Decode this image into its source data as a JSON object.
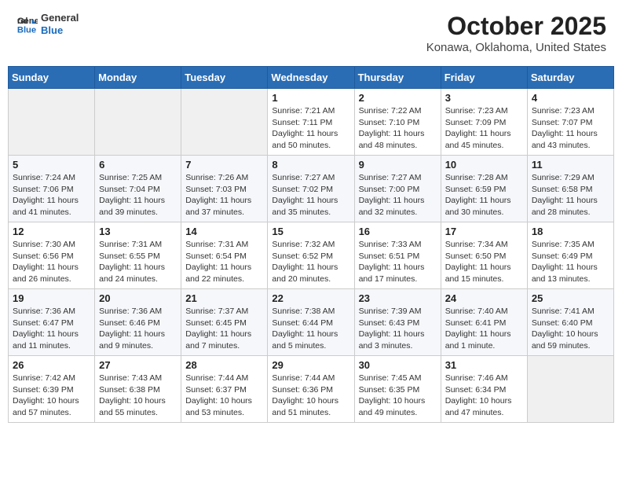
{
  "header": {
    "logo_line1": "General",
    "logo_line2": "Blue",
    "title": "October 2025",
    "subtitle": "Konawa, Oklahoma, United States"
  },
  "days_of_week": [
    "Sunday",
    "Monday",
    "Tuesday",
    "Wednesday",
    "Thursday",
    "Friday",
    "Saturday"
  ],
  "weeks": [
    [
      {
        "day": "",
        "info": ""
      },
      {
        "day": "",
        "info": ""
      },
      {
        "day": "",
        "info": ""
      },
      {
        "day": "1",
        "info": "Sunrise: 7:21 AM\nSunset: 7:11 PM\nDaylight: 11 hours\nand 50 minutes."
      },
      {
        "day": "2",
        "info": "Sunrise: 7:22 AM\nSunset: 7:10 PM\nDaylight: 11 hours\nand 48 minutes."
      },
      {
        "day": "3",
        "info": "Sunrise: 7:23 AM\nSunset: 7:09 PM\nDaylight: 11 hours\nand 45 minutes."
      },
      {
        "day": "4",
        "info": "Sunrise: 7:23 AM\nSunset: 7:07 PM\nDaylight: 11 hours\nand 43 minutes."
      }
    ],
    [
      {
        "day": "5",
        "info": "Sunrise: 7:24 AM\nSunset: 7:06 PM\nDaylight: 11 hours\nand 41 minutes."
      },
      {
        "day": "6",
        "info": "Sunrise: 7:25 AM\nSunset: 7:04 PM\nDaylight: 11 hours\nand 39 minutes."
      },
      {
        "day": "7",
        "info": "Sunrise: 7:26 AM\nSunset: 7:03 PM\nDaylight: 11 hours\nand 37 minutes."
      },
      {
        "day": "8",
        "info": "Sunrise: 7:27 AM\nSunset: 7:02 PM\nDaylight: 11 hours\nand 35 minutes."
      },
      {
        "day": "9",
        "info": "Sunrise: 7:27 AM\nSunset: 7:00 PM\nDaylight: 11 hours\nand 32 minutes."
      },
      {
        "day": "10",
        "info": "Sunrise: 7:28 AM\nSunset: 6:59 PM\nDaylight: 11 hours\nand 30 minutes."
      },
      {
        "day": "11",
        "info": "Sunrise: 7:29 AM\nSunset: 6:58 PM\nDaylight: 11 hours\nand 28 minutes."
      }
    ],
    [
      {
        "day": "12",
        "info": "Sunrise: 7:30 AM\nSunset: 6:56 PM\nDaylight: 11 hours\nand 26 minutes."
      },
      {
        "day": "13",
        "info": "Sunrise: 7:31 AM\nSunset: 6:55 PM\nDaylight: 11 hours\nand 24 minutes."
      },
      {
        "day": "14",
        "info": "Sunrise: 7:31 AM\nSunset: 6:54 PM\nDaylight: 11 hours\nand 22 minutes."
      },
      {
        "day": "15",
        "info": "Sunrise: 7:32 AM\nSunset: 6:52 PM\nDaylight: 11 hours\nand 20 minutes."
      },
      {
        "day": "16",
        "info": "Sunrise: 7:33 AM\nSunset: 6:51 PM\nDaylight: 11 hours\nand 17 minutes."
      },
      {
        "day": "17",
        "info": "Sunrise: 7:34 AM\nSunset: 6:50 PM\nDaylight: 11 hours\nand 15 minutes."
      },
      {
        "day": "18",
        "info": "Sunrise: 7:35 AM\nSunset: 6:49 PM\nDaylight: 11 hours\nand 13 minutes."
      }
    ],
    [
      {
        "day": "19",
        "info": "Sunrise: 7:36 AM\nSunset: 6:47 PM\nDaylight: 11 hours\nand 11 minutes."
      },
      {
        "day": "20",
        "info": "Sunrise: 7:36 AM\nSunset: 6:46 PM\nDaylight: 11 hours\nand 9 minutes."
      },
      {
        "day": "21",
        "info": "Sunrise: 7:37 AM\nSunset: 6:45 PM\nDaylight: 11 hours\nand 7 minutes."
      },
      {
        "day": "22",
        "info": "Sunrise: 7:38 AM\nSunset: 6:44 PM\nDaylight: 11 hours\nand 5 minutes."
      },
      {
        "day": "23",
        "info": "Sunrise: 7:39 AM\nSunset: 6:43 PM\nDaylight: 11 hours\nand 3 minutes."
      },
      {
        "day": "24",
        "info": "Sunrise: 7:40 AM\nSunset: 6:41 PM\nDaylight: 11 hours\nand 1 minute."
      },
      {
        "day": "25",
        "info": "Sunrise: 7:41 AM\nSunset: 6:40 PM\nDaylight: 10 hours\nand 59 minutes."
      }
    ],
    [
      {
        "day": "26",
        "info": "Sunrise: 7:42 AM\nSunset: 6:39 PM\nDaylight: 10 hours\nand 57 minutes."
      },
      {
        "day": "27",
        "info": "Sunrise: 7:43 AM\nSunset: 6:38 PM\nDaylight: 10 hours\nand 55 minutes."
      },
      {
        "day": "28",
        "info": "Sunrise: 7:44 AM\nSunset: 6:37 PM\nDaylight: 10 hours\nand 53 minutes."
      },
      {
        "day": "29",
        "info": "Sunrise: 7:44 AM\nSunset: 6:36 PM\nDaylight: 10 hours\nand 51 minutes."
      },
      {
        "day": "30",
        "info": "Sunrise: 7:45 AM\nSunset: 6:35 PM\nDaylight: 10 hours\nand 49 minutes."
      },
      {
        "day": "31",
        "info": "Sunrise: 7:46 AM\nSunset: 6:34 PM\nDaylight: 10 hours\nand 47 minutes."
      },
      {
        "day": "",
        "info": ""
      }
    ]
  ]
}
